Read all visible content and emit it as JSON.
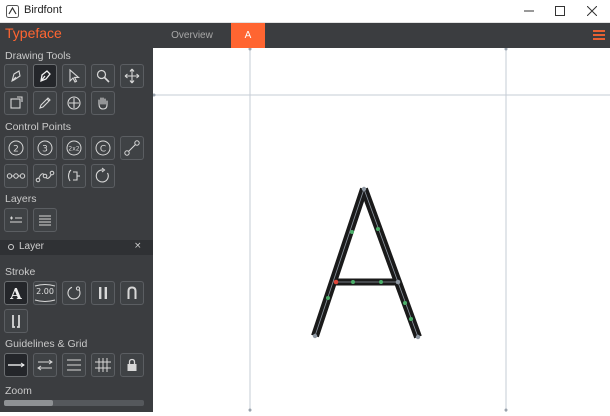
{
  "window": {
    "title": "Birdfont",
    "icons": {
      "app": "birdfont-icon",
      "minimize": "minimize-icon",
      "maximize": "maximize-icon",
      "close": "close-icon"
    }
  },
  "sidebar": {
    "brand": "Typeface",
    "sections": {
      "drawing_tools": "Drawing Tools",
      "control_points": "Control Points",
      "layers": "Layers",
      "stroke": "Stroke",
      "guidelines": "Guidelines & Grid",
      "zoom": "Zoom"
    },
    "drawing_tools": [
      "pen-icon",
      "bezier-tool-icon",
      "pointer-icon",
      "zoom-icon",
      "move-icon",
      "resize-icon",
      "pencil-icon",
      "center-icon",
      "hand-icon"
    ],
    "control_points": [
      "quadratic-2-icon",
      "cubic-3-icon",
      "double-2x2-icon",
      "convert-c-icon",
      "line-points-icon",
      "point-chain-icon",
      "curve-points-icon",
      "reverse-path-icon",
      "rotate-icon"
    ],
    "layers": [
      "add-layer-icon",
      "layers-list-icon"
    ],
    "layer_item": {
      "label": "Layer",
      "close": "×"
    },
    "stroke_width": "2.00",
    "stroke_tools": [
      "serif-a-icon",
      "stroke-width-icon",
      "circle-path-icon",
      "stroke-columns-icon",
      "stroke-arch-icon",
      "stroke-bracket-icon"
    ],
    "guideline_tools": [
      "horizontal-line-icon",
      "arrows-icon",
      "list-lines-icon",
      "grid-icon",
      "lock-icon"
    ],
    "zoom_level": 0.35
  },
  "tabs": [
    {
      "label": "Overview",
      "active": false
    },
    {
      "label": "A",
      "active": true
    }
  ],
  "colors": {
    "accent": "#ff6531",
    "sidebar_bg": "#3b3d40",
    "stroke": "#1a1a1a",
    "guide": "#c5ccd6",
    "point_green": "#4caf6a",
    "point_red": "#e0463a"
  }
}
